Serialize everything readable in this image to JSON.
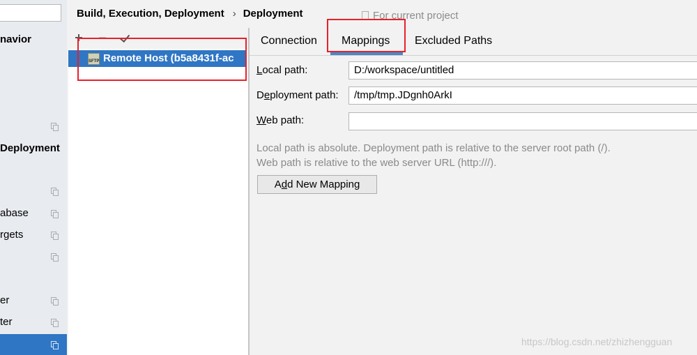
{
  "left_tree": {
    "items": [
      {
        "label": "navior",
        "bold": true,
        "icon": "",
        "selected": false
      },
      {
        "label": "",
        "bold": false,
        "icon": "copy-icon",
        "selected": false
      },
      {
        "label": "Deployment",
        "bold": true,
        "icon": "",
        "selected": false
      },
      {
        "label": "",
        "bold": false,
        "icon": "copy-icon",
        "selected": false
      },
      {
        "label": "abase",
        "bold": false,
        "icon": "copy-icon",
        "selected": false
      },
      {
        "label": "rgets",
        "bold": false,
        "icon": "copy-icon",
        "selected": false
      },
      {
        "label": "",
        "bold": false,
        "icon": "copy-icon",
        "selected": false
      },
      {
        "label": "er",
        "bold": false,
        "icon": "copy-icon",
        "selected": false
      },
      {
        "label": "ter",
        "bold": false,
        "icon": "copy-icon",
        "selected": false
      },
      {
        "label": "",
        "bold": false,
        "icon": "copy-icon",
        "selected": true
      }
    ]
  },
  "header": {
    "breadcrumb_parent": "Build, Execution, Deployment",
    "breadcrumb_separator": "›",
    "breadcrumb_current": "Deployment",
    "scope_label": "For current project"
  },
  "server_list": {
    "selected_server": "Remote Host (b5a8431f-ac",
    "server_icon_text": "SFTP"
  },
  "tabs": [
    {
      "label": "Connection",
      "active": false
    },
    {
      "label": "Mappings",
      "active": true
    },
    {
      "label": "Excluded Paths",
      "active": false
    }
  ],
  "form": {
    "local_path_mnemonic": "L",
    "local_path_label_rest": "ocal path:",
    "local_path_value": "D:/workspace/untitled",
    "deployment_path_prefix": "D",
    "deployment_path_mnemonic": "e",
    "deployment_path_label_rest": "ployment path:",
    "deployment_path_value": "/tmp/tmp.JDgnh0ArkI",
    "web_path_mnemonic": "W",
    "web_path_label_rest": "eb path:",
    "web_path_value": ""
  },
  "hints": {
    "line1": "Local path is absolute. Deployment path is relative to the server root path (/).",
    "line2": "Web path is relative to the web server URL (http:///)."
  },
  "add_mapping_button": {
    "prefix": "A",
    "mnemonic": "d",
    "rest": "d New Mapping"
  },
  "watermark": "https://blog.csdn.net/zhizhengguan",
  "colors": {
    "selection_blue": "#2f76c4",
    "tab_underline": "#4a88c7",
    "highlight_red": "#e8202a",
    "hint_gray": "#8a8a8a"
  }
}
